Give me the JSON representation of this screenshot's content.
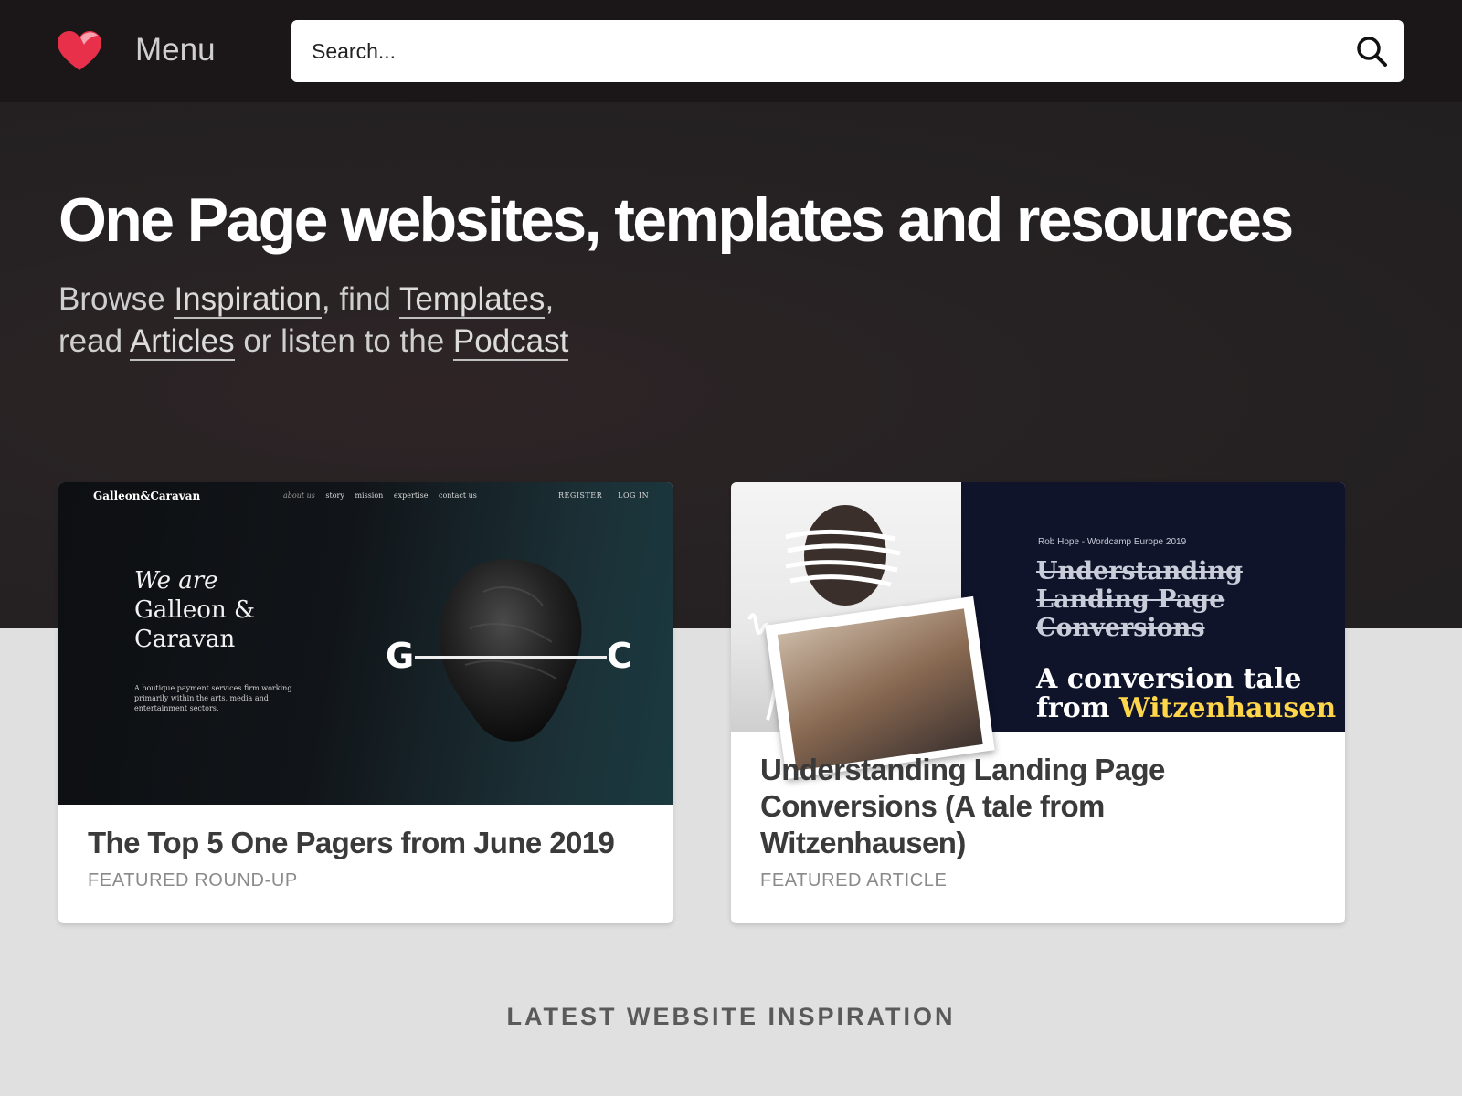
{
  "header": {
    "logo_icon": "heart-icon",
    "menu_label": "Menu",
    "search_placeholder": "Search...",
    "search_icon": "search-icon",
    "brand_color": "#e8304a"
  },
  "hero": {
    "title": "One Page websites, templates and resources",
    "sub": {
      "browse": "Browse ",
      "inspiration": "Inspiration",
      "find": ", find ",
      "templates": "Templates",
      "comma": ",",
      "read": "read ",
      "articles": "Articles",
      "listen": " or listen to the ",
      "podcast": "Podcast"
    }
  },
  "cards": [
    {
      "title": "The Top 5 One Pagers from June 2019",
      "kicker": "FEATURED ROUND-UP",
      "thumbnail": {
        "brand": "Galleon&Caravan",
        "nav": [
          "about us",
          "story",
          "mission",
          "expertise",
          "contact us"
        ],
        "auth": [
          "REGISTER",
          "LOG IN"
        ],
        "headline_italic": "We are",
        "headline_line2": "Galleon &",
        "headline_line3": "Caravan",
        "blurb": "A boutique payment services firm working primarily within the arts, media and entertainment sectors.",
        "mark_left": "G",
        "mark_right": "C"
      }
    },
    {
      "title": "Understanding Landing Page Conversions (A tale from Witzenhausen)",
      "kicker": "FEATURED ARTICLE",
      "thumbnail": {
        "meta": "Rob Hope - Wordcamp Europe 2019",
        "strike_line1": "Understanding",
        "strike_line2": "Landing Page",
        "strike_line3": "Conversions",
        "tale_line1": "A conversion tale",
        "tale_from": "from ",
        "tale_highlight": "Witzenhausen"
      }
    }
  ],
  "section": {
    "latest_heading": "LATEST WEBSITE INSPIRATION"
  }
}
